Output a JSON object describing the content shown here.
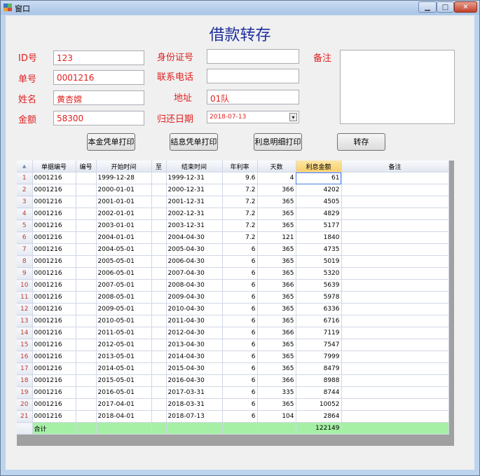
{
  "window": {
    "title": "窗口"
  },
  "form": {
    "title": "借款转存",
    "labels": {
      "id": "ID号",
      "bill_no": "单号",
      "name": "姓名",
      "amount": "金额",
      "id_card": "身份证号",
      "phone": "联系电话",
      "address": "地址",
      "return_date": "归还日期",
      "notes": "备注"
    },
    "values": {
      "id": "123",
      "bill_no": "0001216",
      "name": "黄杏嫦",
      "amount": "58300",
      "id_card": "",
      "phone": "",
      "address": "01队",
      "return_date": "2018-07-13",
      "notes": ""
    }
  },
  "buttons": {
    "print_principal": "本金凭单打印",
    "print_settlement": "结息凭单打印",
    "print_interest_detail": "利息明细打印",
    "transfer": "转存"
  },
  "grid": {
    "corner": "▲",
    "columns": [
      "单据编号",
      "编号",
      "开始时间",
      "至",
      "结束时间",
      "年利率",
      "天数",
      "利息金额",
      "备注"
    ],
    "rows": [
      {
        "n": "1",
        "bill": "0001216",
        "code": "",
        "start": "1999-12-28",
        "to": "",
        "end": "1999-12-31",
        "rate": "9.6",
        "days": "4",
        "interest": "61",
        "note": ""
      },
      {
        "n": "2",
        "bill": "0001216",
        "code": "",
        "start": "2000-01-01",
        "to": "",
        "end": "2000-12-31",
        "rate": "7.2",
        "days": "366",
        "interest": "4202",
        "note": ""
      },
      {
        "n": "3",
        "bill": "0001216",
        "code": "",
        "start": "2001-01-01",
        "to": "",
        "end": "2001-12-31",
        "rate": "7.2",
        "days": "365",
        "interest": "4505",
        "note": ""
      },
      {
        "n": "4",
        "bill": "0001216",
        "code": "",
        "start": "2002-01-01",
        "to": "",
        "end": "2002-12-31",
        "rate": "7.2",
        "days": "365",
        "interest": "4829",
        "note": ""
      },
      {
        "n": "5",
        "bill": "0001216",
        "code": "",
        "start": "2003-01-01",
        "to": "",
        "end": "2003-12-31",
        "rate": "7.2",
        "days": "365",
        "interest": "5177",
        "note": ""
      },
      {
        "n": "6",
        "bill": "0001216",
        "code": "",
        "start": "2004-01-01",
        "to": "",
        "end": "2004-04-30",
        "rate": "7.2",
        "days": "121",
        "interest": "1840",
        "note": ""
      },
      {
        "n": "7",
        "bill": "0001216",
        "code": "",
        "start": "2004-05-01",
        "to": "",
        "end": "2005-04-30",
        "rate": "6",
        "days": "365",
        "interest": "4735",
        "note": ""
      },
      {
        "n": "8",
        "bill": "0001216",
        "code": "",
        "start": "2005-05-01",
        "to": "",
        "end": "2006-04-30",
        "rate": "6",
        "days": "365",
        "interest": "5019",
        "note": ""
      },
      {
        "n": "9",
        "bill": "0001216",
        "code": "",
        "start": "2006-05-01",
        "to": "",
        "end": "2007-04-30",
        "rate": "6",
        "days": "365",
        "interest": "5320",
        "note": ""
      },
      {
        "n": "10",
        "bill": "0001216",
        "code": "",
        "start": "2007-05-01",
        "to": "",
        "end": "2008-04-30",
        "rate": "6",
        "days": "366",
        "interest": "5639",
        "note": ""
      },
      {
        "n": "11",
        "bill": "0001216",
        "code": "",
        "start": "2008-05-01",
        "to": "",
        "end": "2009-04-30",
        "rate": "6",
        "days": "365",
        "interest": "5978",
        "note": ""
      },
      {
        "n": "12",
        "bill": "0001216",
        "code": "",
        "start": "2009-05-01",
        "to": "",
        "end": "2010-04-30",
        "rate": "6",
        "days": "365",
        "interest": "6336",
        "note": ""
      },
      {
        "n": "13",
        "bill": "0001216",
        "code": "",
        "start": "2010-05-01",
        "to": "",
        "end": "2011-04-30",
        "rate": "6",
        "days": "365",
        "interest": "6716",
        "note": ""
      },
      {
        "n": "14",
        "bill": "0001216",
        "code": "",
        "start": "2011-05-01",
        "to": "",
        "end": "2012-04-30",
        "rate": "6",
        "days": "366",
        "interest": "7119",
        "note": ""
      },
      {
        "n": "15",
        "bill": "0001216",
        "code": "",
        "start": "2012-05-01",
        "to": "",
        "end": "2013-04-30",
        "rate": "6",
        "days": "365",
        "interest": "7547",
        "note": ""
      },
      {
        "n": "16",
        "bill": "0001216",
        "code": "",
        "start": "2013-05-01",
        "to": "",
        "end": "2014-04-30",
        "rate": "6",
        "days": "365",
        "interest": "7999",
        "note": ""
      },
      {
        "n": "17",
        "bill": "0001216",
        "code": "",
        "start": "2014-05-01",
        "to": "",
        "end": "2015-04-30",
        "rate": "6",
        "days": "365",
        "interest": "8479",
        "note": ""
      },
      {
        "n": "18",
        "bill": "0001216",
        "code": "",
        "start": "2015-05-01",
        "to": "",
        "end": "2016-04-30",
        "rate": "6",
        "days": "366",
        "interest": "8988",
        "note": ""
      },
      {
        "n": "19",
        "bill": "0001216",
        "code": "",
        "start": "2016-05-01",
        "to": "",
        "end": "2017-03-31",
        "rate": "6",
        "days": "335",
        "interest": "8744",
        "note": ""
      },
      {
        "n": "20",
        "bill": "0001216",
        "code": "",
        "start": "2017-04-01",
        "to": "",
        "end": "2018-03-31",
        "rate": "6",
        "days": "365",
        "interest": "10052",
        "note": ""
      },
      {
        "n": "21",
        "bill": "0001216",
        "code": "",
        "start": "2018-04-01",
        "to": "",
        "end": "2018-07-13",
        "rate": "6",
        "days": "104",
        "interest": "2864",
        "note": ""
      }
    ],
    "summary": {
      "label": "合计",
      "interest": "122149"
    }
  },
  "colors": {
    "label": "#e02020",
    "title": "#1d2d9c",
    "summary_row": "#a6f0a6",
    "sorted_header": "#f9cf6a"
  },
  "icons": {
    "app": "app-window-icon",
    "minimize": "minimize-icon",
    "maximize": "maximize-icon",
    "close": "close-icon",
    "dropdown": "chevron-down-icon"
  }
}
